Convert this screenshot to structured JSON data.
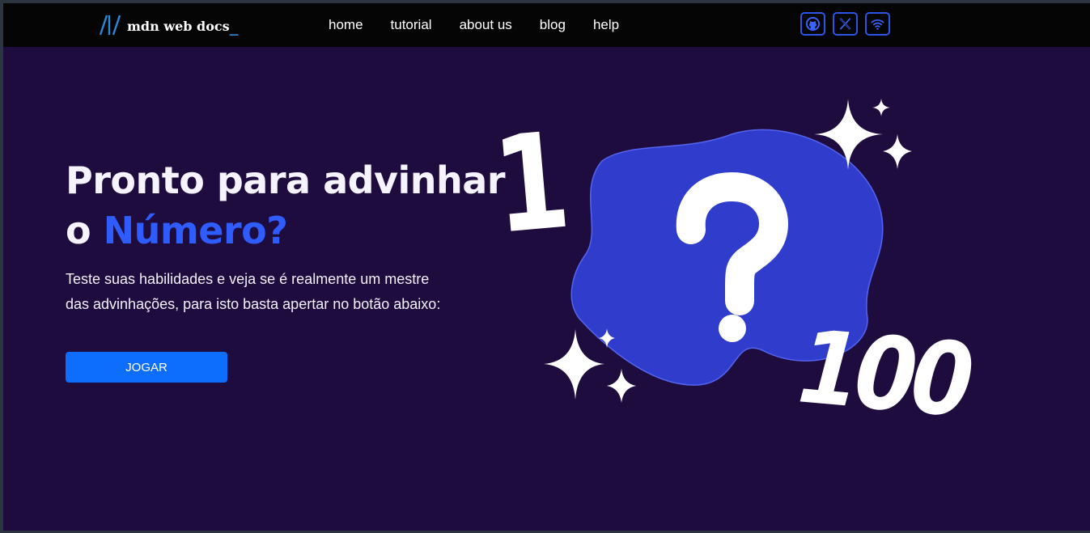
{
  "header": {
    "logo_text": "mdn web docs",
    "logo_cursor": "_",
    "nav": [
      {
        "label": "home"
      },
      {
        "label": "tutorial"
      },
      {
        "label": "about us"
      },
      {
        "label": "blog"
      },
      {
        "label": "help"
      }
    ],
    "social_icons": [
      "github-icon",
      "x-icon",
      "wifi-icon"
    ]
  },
  "hero": {
    "title_line1": "Pronto para advinhar",
    "title_line2_prefix": "o ",
    "title_line2_accent": "Número?",
    "description": "Teste suas habilidades e veja se é realmente um mestre das advinhações, para isto basta apertar no botão abaixo:",
    "play_button": "JOGAR"
  },
  "illustration": {
    "number_low": "1",
    "number_high": "100",
    "symbol": "?"
  },
  "colors": {
    "page_background": "#1e0c3e",
    "topbar_background": "#050505",
    "accent": "#2f5cff",
    "button": "#0d6efd",
    "blob": "#2f3ccc",
    "icon_border": "#2a55e6"
  }
}
